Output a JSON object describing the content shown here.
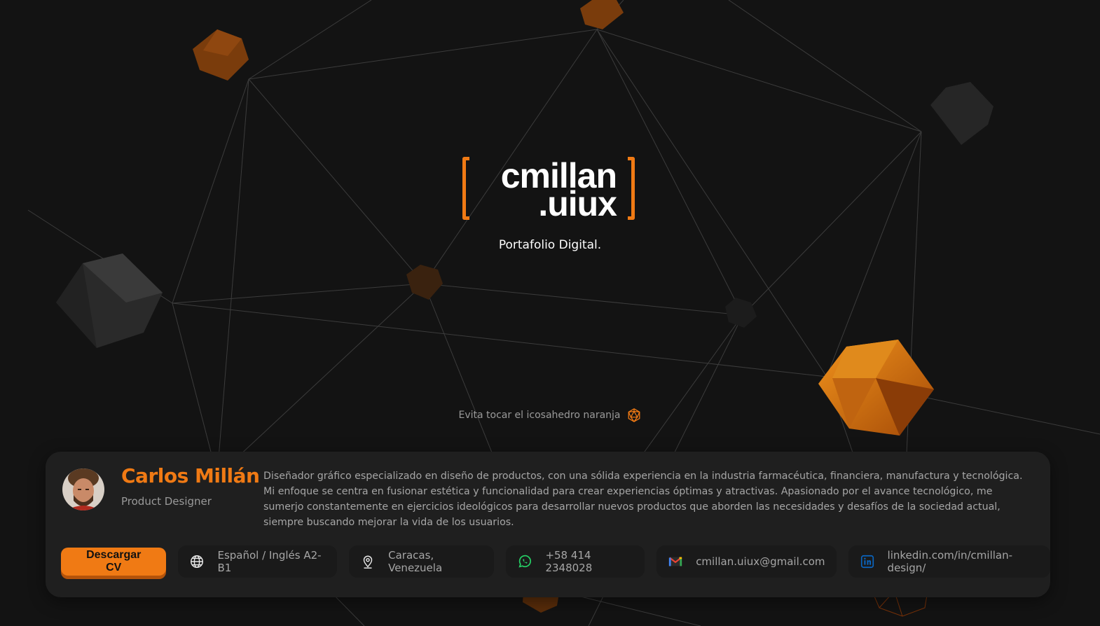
{
  "hero": {
    "logo": {
      "line1": "cmillan",
      "line2": ".uiux"
    },
    "tagline": "Portafolio Digital.",
    "hint": {
      "text": "Evita tocar el icosahedro naranja",
      "icon": "icosahedron-icon"
    }
  },
  "profile": {
    "name": "Carlos Millán",
    "role": "Product Designer",
    "bio": "Diseñador gráfico especializado en diseño de productos, con una sólida experiencia en la industria farmacéutica, financiera, manufactura y tecnológica. Mi enfoque se centra en fusionar estética y funcionalidad para crear experiencias óptimas y atractivas. Apasionado por el avance tecnológico, me sumerjo constantemente en ejercicios ideológicos para desarrollar nuevos productos que aborden las necesidades y desafíos de la sociedad actual, siempre buscando mejorar la vida de los usuarios."
  },
  "actions": {
    "download_cv": "Descargar CV",
    "info": [
      {
        "icon": "globe-icon",
        "text": "Español / Inglés A2-B1"
      },
      {
        "icon": "location-pin-icon",
        "text": "Caracas, Venezuela"
      },
      {
        "icon": "whatsapp-icon",
        "text": "+58 414 2348028"
      },
      {
        "icon": "gmail-icon",
        "text": "cmillan.uiux@gmail.com"
      },
      {
        "icon": "linkedin-icon",
        "text": "linkedin.com/in/cmillan-design/"
      }
    ]
  },
  "colors": {
    "accent": "#f07a14",
    "background": "#131313",
    "card": "#1f1f1f",
    "whatsapp": "#25d366",
    "linkedin": "#0a66c2"
  }
}
